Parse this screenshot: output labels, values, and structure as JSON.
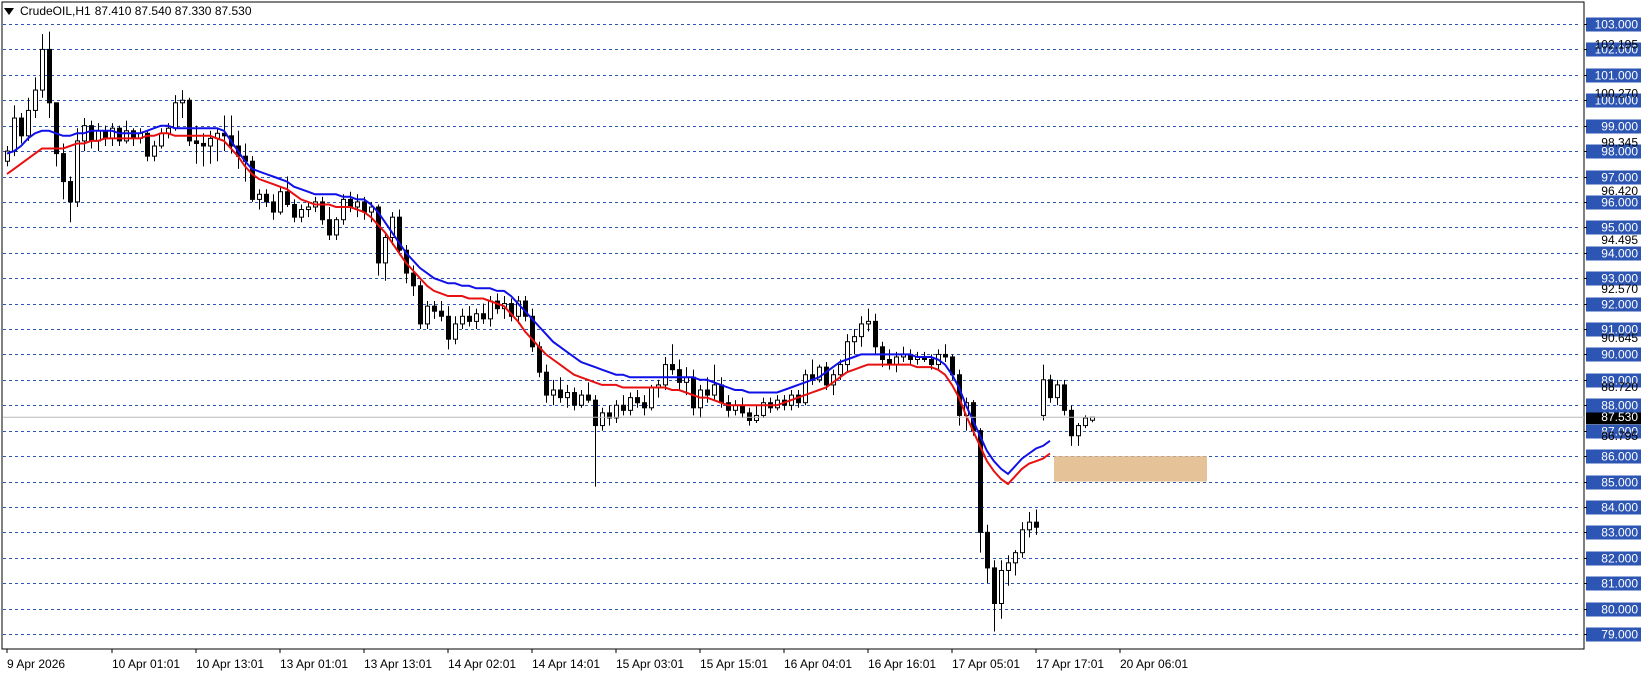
{
  "header": {
    "symbol_timeframe": "CrudeOIL,H1",
    "ohlc_text": "87.410 87.540 87.330 87.530"
  },
  "colors": {
    "grid": "#2d55b3",
    "label_bg": "#2d55b3",
    "ema_fast": "#1010e8",
    "ema_slow": "#e81010",
    "zone": "#e2b787",
    "current_price_bg": "#000000"
  },
  "chart_data": {
    "type": "candlestick",
    "symbol": "CrudeOIL",
    "timeframe": "H1",
    "ylim": [
      78.8,
      103.8
    ],
    "y_ticks": [
      103,
      102,
      101,
      100,
      99,
      98,
      97,
      96,
      95,
      94,
      93,
      92,
      91,
      90,
      89,
      88,
      87,
      86,
      85,
      84,
      83,
      82,
      81,
      80,
      79
    ],
    "y_tick_labels": [
      "103.000",
      "102.000",
      "101.000",
      "100.000",
      "99.000",
      "98.000",
      "97.000",
      "96.000",
      "95.000",
      "94.000",
      "93.000",
      "92.000",
      "91.000",
      "90.000",
      "89.000",
      "88.000",
      "87.000",
      "86.000",
      "85.000",
      "84.000",
      "83.000",
      "82.000",
      "81.000",
      "80.000",
      "79.000"
    ],
    "secondary_labels": [
      {
        "value": 102.195,
        "text": "102.195"
      },
      {
        "value": 100.27,
        "text": "100.270"
      },
      {
        "value": 98.345,
        "text": "98.345"
      },
      {
        "value": 96.42,
        "text": "96.420"
      },
      {
        "value": 94.495,
        "text": "94.495"
      },
      {
        "value": 92.57,
        "text": "92.570"
      },
      {
        "value": 90.645,
        "text": "90.645"
      },
      {
        "value": 88.72,
        "text": "88.720"
      },
      {
        "value": 86.795,
        "text": "86.795"
      }
    ],
    "current_price": {
      "value": 87.53,
      "text": "87.530"
    },
    "x_labels": [
      {
        "bar": 0,
        "text": "9 Apr 2026"
      },
      {
        "bar": 15,
        "text": "10 Apr 01:01"
      },
      {
        "bar": 27,
        "text": "10 Apr 13:01"
      },
      {
        "bar": 39,
        "text": "13 Apr 01:01"
      },
      {
        "bar": 51,
        "text": "13 Apr 13:01"
      },
      {
        "bar": 63,
        "text": "14 Apr 02:01"
      },
      {
        "bar": 75,
        "text": "14 Apr 14:01"
      },
      {
        "bar": 87,
        "text": "15 Apr 03:01"
      },
      {
        "bar": 99,
        "text": "15 Apr 15:01"
      },
      {
        "bar": 111,
        "text": "16 Apr 04:01"
      },
      {
        "bar": 123,
        "text": "16 Apr 16:01"
      },
      {
        "bar": 135,
        "text": "17 Apr 05:01"
      },
      {
        "bar": 147,
        "text": "17 Apr 17:01"
      },
      {
        "bar": 159,
        "text": "20 Apr 06:01"
      }
    ],
    "zone": {
      "from_bar": 150,
      "to_bar": 171,
      "low": 85.0,
      "high": 86.0
    },
    "series": [
      {
        "key": "ema_fast",
        "values": [
          97.9,
          98.0,
          98.2,
          98.5,
          98.7,
          98.8,
          98.8,
          98.7,
          98.6,
          98.6,
          98.7,
          98.7,
          98.8,
          98.8,
          98.8,
          98.8,
          98.7,
          98.7,
          98.7,
          98.7,
          98.8,
          98.9,
          99.0,
          99.0,
          98.9,
          98.9,
          98.9,
          98.9,
          98.9,
          98.9,
          98.9,
          98.8,
          98.4,
          98.0,
          97.6,
          97.3,
          97.2,
          97.1,
          97.0,
          96.9,
          96.8,
          96.6,
          96.5,
          96.4,
          96.3,
          96.3,
          96.3,
          96.3,
          96.2,
          96.2,
          96.1,
          96.1,
          95.9,
          95.6,
          95.2,
          94.8,
          94.4,
          94.0,
          93.7,
          93.4,
          93.2,
          93.0,
          92.9,
          92.8,
          92.8,
          92.7,
          92.7,
          92.6,
          92.6,
          92.6,
          92.5,
          92.5,
          92.3,
          92.0,
          91.7,
          91.4,
          91.1,
          90.8,
          90.5,
          90.3,
          90.1,
          89.9,
          89.7,
          89.6,
          89.5,
          89.4,
          89.3,
          89.2,
          89.2,
          89.1,
          89.1,
          89.1,
          89.1,
          89.1,
          89.1,
          89.1,
          89.1,
          89.1,
          89.1,
          89.0,
          89.0,
          88.9,
          88.8,
          88.7,
          88.6,
          88.6,
          88.5,
          88.5,
          88.5,
          88.5,
          88.5,
          88.6,
          88.7,
          88.8,
          88.9,
          89.0,
          89.1,
          89.3,
          89.5,
          89.7,
          89.8,
          89.9,
          90.0,
          90.0,
          90.0,
          90.0,
          90.0,
          90.0,
          90.0,
          90.0,
          89.9,
          89.9,
          89.9,
          89.8,
          89.6,
          89.2,
          88.7,
          88.0,
          87.4,
          86.8,
          86.2,
          85.8,
          85.5,
          85.3,
          85.6,
          85.9,
          86.1,
          86.3,
          86.4,
          86.6
        ]
      },
      {
        "key": "ema_slow",
        "values": [
          97.1,
          97.3,
          97.5,
          97.7,
          97.9,
          98.1,
          98.1,
          98.1,
          98.1,
          98.2,
          98.3,
          98.3,
          98.4,
          98.4,
          98.5,
          98.5,
          98.5,
          98.5,
          98.5,
          98.5,
          98.6,
          98.6,
          98.7,
          98.7,
          98.6,
          98.6,
          98.6,
          98.6,
          98.6,
          98.6,
          98.5,
          98.4,
          98.1,
          97.8,
          97.4,
          97.1,
          96.9,
          96.8,
          96.7,
          96.6,
          96.5,
          96.3,
          96.1,
          96.0,
          95.9,
          95.9,
          95.9,
          95.8,
          95.8,
          95.8,
          95.7,
          95.6,
          95.4,
          95.1,
          94.8,
          94.4,
          94.0,
          93.6,
          93.3,
          93.0,
          92.7,
          92.5,
          92.4,
          92.3,
          92.3,
          92.3,
          92.2,
          92.2,
          92.2,
          92.1,
          92.0,
          91.9,
          91.6,
          91.3,
          90.9,
          90.6,
          90.3,
          90.0,
          89.8,
          89.6,
          89.4,
          89.2,
          89.1,
          89.0,
          88.9,
          88.8,
          88.8,
          88.8,
          88.7,
          88.7,
          88.7,
          88.7,
          88.7,
          88.7,
          88.7,
          88.6,
          88.6,
          88.5,
          88.4,
          88.3,
          88.3,
          88.2,
          88.1,
          88.0,
          88.0,
          88.0,
          88.0,
          88.0,
          88.0,
          88.0,
          88.0,
          88.1,
          88.2,
          88.3,
          88.4,
          88.5,
          88.6,
          88.7,
          88.9,
          89.1,
          89.3,
          89.4,
          89.5,
          89.6,
          89.6,
          89.6,
          89.6,
          89.6,
          89.6,
          89.6,
          89.5,
          89.5,
          89.5,
          89.4,
          89.2,
          88.8,
          88.3,
          87.6,
          87.0,
          86.4,
          85.8,
          85.4,
          85.1,
          84.9,
          85.2,
          85.5,
          85.7,
          85.8,
          85.9,
          86.1
        ]
      }
    ],
    "ohlc": [
      [
        97.6,
        98.2,
        97.4,
        98.0
      ],
      [
        98.0,
        99.8,
        97.8,
        99.3
      ],
      [
        99.3,
        99.5,
        98.3,
        98.6
      ],
      [
        98.6,
        100.1,
        98.4,
        99.6
      ],
      [
        99.6,
        100.9,
        99.3,
        100.4
      ],
      [
        100.4,
        102.6,
        100.1,
        102.0
      ],
      [
        102.0,
        102.7,
        99.3,
        99.9
      ],
      [
        99.9,
        99.9,
        97.4,
        97.9
      ],
      [
        97.9,
        98.3,
        96.1,
        96.8
      ],
      [
        96.8,
        97.0,
        95.2,
        96.0
      ],
      [
        96.0,
        98.9,
        95.8,
        98.4
      ],
      [
        98.4,
        99.3,
        98.0,
        99.0
      ],
      [
        99.0,
        99.2,
        98.1,
        98.4
      ],
      [
        98.4,
        99.1,
        98.0,
        98.8
      ],
      [
        98.8,
        99.0,
        98.2,
        98.5
      ],
      [
        98.5,
        99.1,
        98.2,
        98.9
      ],
      [
        98.9,
        99.0,
        98.2,
        98.4
      ],
      [
        98.4,
        99.2,
        98.3,
        98.8
      ],
      [
        98.8,
        98.9,
        98.2,
        98.5
      ],
      [
        98.5,
        98.9,
        98.3,
        98.7
      ],
      [
        98.7,
        98.8,
        97.6,
        97.8
      ],
      [
        97.8,
        98.4,
        97.6,
        98.2
      ],
      [
        98.2,
        98.9,
        98.1,
        98.7
      ],
      [
        98.7,
        99.1,
        98.5,
        98.9
      ],
      [
        98.9,
        100.2,
        98.8,
        99.9
      ],
      [
        99.9,
        100.4,
        99.3,
        100.0
      ],
      [
        100.0,
        100.1,
        98.2,
        98.4
      ],
      [
        98.4,
        99.0,
        97.5,
        98.3
      ],
      [
        98.3,
        98.7,
        97.4,
        98.2
      ],
      [
        98.2,
        98.8,
        97.5,
        98.5
      ],
      [
        98.5,
        98.9,
        97.6,
        98.7
      ],
      [
        98.7,
        99.4,
        98.0,
        98.6
      ],
      [
        98.6,
        99.4,
        97.9,
        98.2
      ],
      [
        98.2,
        98.8,
        97.3,
        97.8
      ],
      [
        97.8,
        98.3,
        96.8,
        97.6
      ],
      [
        97.6,
        97.8,
        96.0,
        96.1
      ],
      [
        96.1,
        96.5,
        95.7,
        96.3
      ],
      [
        96.3,
        96.5,
        95.8,
        96.0
      ],
      [
        96.0,
        96.3,
        95.3,
        95.6
      ],
      [
        95.6,
        96.6,
        95.5,
        96.4
      ],
      [
        96.4,
        97.0,
        95.8,
        95.9
      ],
      [
        95.9,
        96.1,
        95.2,
        95.4
      ],
      [
        95.4,
        95.9,
        95.2,
        95.7
      ],
      [
        95.7,
        96.0,
        95.4,
        95.8
      ],
      [
        95.8,
        96.2,
        95.6,
        96.0
      ],
      [
        96.0,
        96.2,
        95.1,
        95.3
      ],
      [
        95.3,
        95.8,
        94.5,
        94.7
      ],
      [
        94.7,
        95.4,
        94.5,
        95.3
      ],
      [
        95.3,
        96.3,
        95.1,
        96.1
      ],
      [
        96.1,
        96.4,
        95.6,
        95.8
      ],
      [
        95.8,
        96.3,
        95.4,
        96.0
      ],
      [
        96.0,
        96.2,
        95.3,
        95.6
      ],
      [
        95.6,
        96.0,
        95.2,
        95.8
      ],
      [
        95.8,
        95.9,
        93.1,
        93.6
      ],
      [
        93.6,
        94.8,
        92.9,
        94.6
      ],
      [
        94.6,
        95.6,
        94.3,
        95.4
      ],
      [
        95.4,
        95.7,
        93.9,
        94.1
      ],
      [
        94.1,
        94.3,
        92.8,
        93.2
      ],
      [
        93.2,
        93.5,
        92.3,
        92.7
      ],
      [
        92.7,
        92.9,
        91.0,
        91.2
      ],
      [
        91.2,
        92.1,
        91.0,
        91.9
      ],
      [
        91.9,
        92.1,
        91.4,
        91.7
      ],
      [
        91.7,
        92.1,
        91.3,
        91.5
      ],
      [
        91.5,
        91.9,
        90.2,
        90.6
      ],
      [
        90.6,
        91.5,
        90.4,
        91.2
      ],
      [
        91.2,
        91.8,
        91.0,
        91.5
      ],
      [
        91.5,
        91.9,
        91.1,
        91.3
      ],
      [
        91.3,
        91.8,
        91.0,
        91.6
      ],
      [
        91.6,
        92.0,
        91.2,
        91.4
      ],
      [
        91.4,
        92.3,
        91.1,
        92.1
      ],
      [
        92.1,
        92.4,
        91.6,
        91.8
      ],
      [
        91.8,
        92.3,
        91.4,
        92.0
      ],
      [
        92.0,
        92.2,
        91.3,
        91.5
      ],
      [
        91.5,
        92.3,
        91.2,
        92.1
      ],
      [
        92.1,
        92.3,
        91.3,
        91.5
      ],
      [
        91.5,
        91.8,
        90.1,
        90.3
      ],
      [
        90.3,
        90.5,
        89.1,
        89.3
      ],
      [
        89.3,
        89.6,
        88.1,
        88.4
      ],
      [
        88.4,
        89.0,
        88.0,
        88.6
      ],
      [
        88.6,
        89.1,
        88.1,
        88.3
      ],
      [
        88.3,
        88.8,
        87.9,
        88.5
      ],
      [
        88.5,
        88.7,
        87.8,
        88.0
      ],
      [
        88.0,
        88.6,
        87.9,
        88.4
      ],
      [
        88.4,
        88.9,
        88.1,
        88.2
      ],
      [
        88.2,
        88.4,
        84.8,
        87.2
      ],
      [
        87.2,
        87.9,
        87.0,
        87.7
      ],
      [
        87.7,
        88.0,
        87.2,
        87.5
      ],
      [
        87.5,
        88.2,
        87.3,
        88.0
      ],
      [
        88.0,
        88.4,
        87.6,
        87.8
      ],
      [
        87.8,
        88.5,
        87.6,
        88.3
      ],
      [
        88.3,
        88.6,
        87.9,
        88.1
      ],
      [
        88.1,
        88.4,
        87.6,
        87.9
      ],
      [
        87.9,
        88.8,
        87.8,
        88.7
      ],
      [
        88.7,
        89.0,
        88.3,
        88.8
      ],
      [
        88.8,
        89.9,
        88.6,
        89.6
      ],
      [
        89.6,
        90.4,
        89.2,
        89.4
      ],
      [
        89.4,
        89.8,
        88.6,
        88.9
      ],
      [
        88.9,
        89.5,
        88.4,
        89.1
      ],
      [
        89.1,
        89.4,
        87.6,
        87.9
      ],
      [
        87.9,
        88.8,
        87.5,
        88.6
      ],
      [
        88.6,
        89.1,
        88.1,
        88.4
      ],
      [
        88.4,
        89.6,
        88.2,
        88.8
      ],
      [
        88.8,
        89.1,
        87.9,
        88.1
      ],
      [
        88.1,
        88.4,
        87.5,
        87.8
      ],
      [
        87.8,
        88.2,
        87.6,
        88.0
      ],
      [
        88.0,
        88.3,
        87.5,
        87.7
      ],
      [
        87.7,
        87.9,
        87.2,
        87.4
      ],
      [
        87.4,
        88.0,
        87.3,
        87.6
      ],
      [
        87.6,
        88.3,
        87.5,
        88.1
      ],
      [
        88.1,
        88.3,
        87.7,
        87.9
      ],
      [
        87.9,
        88.4,
        87.8,
        88.2
      ],
      [
        88.2,
        88.4,
        87.8,
        88.0
      ],
      [
        88.0,
        88.6,
        87.8,
        88.4
      ],
      [
        88.4,
        88.6,
        87.9,
        88.1
      ],
      [
        88.1,
        89.4,
        88.0,
        89.2
      ],
      [
        89.2,
        89.8,
        88.8,
        89.0
      ],
      [
        89.0,
        89.6,
        88.9,
        89.5
      ],
      [
        89.5,
        89.7,
        88.6,
        88.8
      ],
      [
        88.8,
        89.4,
        88.4,
        89.2
      ],
      [
        89.2,
        89.8,
        89.0,
        89.6
      ],
      [
        89.6,
        90.8,
        89.3,
        90.5
      ],
      [
        90.5,
        91.0,
        90.0,
        90.7
      ],
      [
        90.7,
        91.5,
        90.3,
        91.2
      ],
      [
        91.2,
        91.8,
        90.9,
        91.3
      ],
      [
        91.3,
        91.6,
        90.0,
        90.3
      ],
      [
        90.3,
        90.5,
        89.5,
        89.8
      ],
      [
        89.8,
        90.2,
        89.4,
        89.6
      ],
      [
        89.6,
        90.1,
        89.3,
        89.9
      ],
      [
        89.9,
        90.3,
        89.7,
        90.0
      ],
      [
        90.0,
        90.2,
        89.6,
        89.8
      ],
      [
        89.8,
        90.1,
        89.6,
        89.9
      ],
      [
        89.9,
        90.1,
        89.7,
        89.8
      ],
      [
        89.8,
        90.0,
        89.4,
        89.6
      ],
      [
        89.6,
        90.2,
        89.4,
        90.0
      ],
      [
        90.0,
        90.4,
        89.7,
        89.9
      ],
      [
        89.9,
        90.0,
        89.0,
        89.2
      ],
      [
        89.2,
        89.4,
        87.2,
        87.6
      ],
      [
        87.6,
        88.3,
        87.0,
        88.1
      ],
      [
        88.1,
        88.2,
        86.8,
        87.0
      ],
      [
        87.0,
        87.1,
        82.2,
        83.0
      ],
      [
        83.0,
        83.3,
        81.0,
        81.6
      ],
      [
        81.6,
        81.9,
        79.1,
        80.2
      ],
      [
        80.2,
        81.9,
        79.6,
        81.5
      ],
      [
        81.5,
        82.1,
        80.9,
        81.8
      ],
      [
        81.8,
        82.3,
        81.3,
        82.2
      ],
      [
        82.2,
        83.4,
        82.0,
        83.1
      ],
      [
        83.1,
        83.8,
        82.8,
        83.4
      ],
      [
        83.4,
        83.9,
        82.9,
        83.2
      ],
      [
        87.6,
        89.6,
        87.4,
        89.0
      ],
      [
        89.0,
        89.2,
        88.1,
        88.3
      ],
      [
        88.3,
        89.0,
        88.0,
        88.8
      ],
      [
        88.8,
        89.0,
        87.6,
        87.8
      ],
      [
        87.8,
        88.0,
        86.4,
        86.8
      ],
      [
        86.8,
        87.3,
        86.4,
        87.2
      ],
      [
        87.2,
        87.6,
        87.1,
        87.5
      ],
      [
        87.41,
        87.54,
        87.33,
        87.53
      ]
    ]
  }
}
